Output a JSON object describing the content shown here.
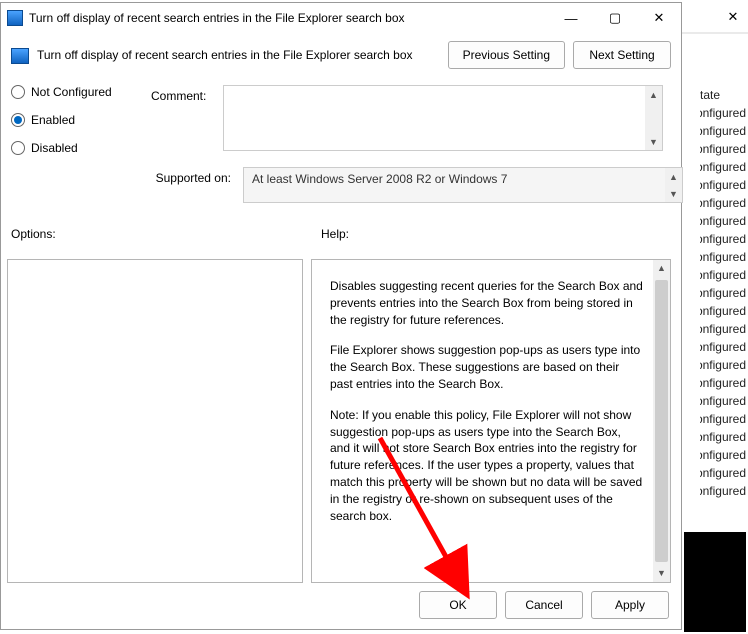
{
  "window": {
    "title": "Turn off display of recent search entries in the File Explorer search box",
    "subtitle": "Turn off display of recent search entries in the File Explorer search box"
  },
  "buttons": {
    "previous": "Previous Setting",
    "next": "Next Setting",
    "ok": "OK",
    "cancel": "Cancel",
    "apply": "Apply"
  },
  "radios": {
    "not_configured": "Not Configured",
    "enabled": "Enabled",
    "disabled": "Disabled",
    "selected": "enabled"
  },
  "labels": {
    "comment": "Comment:",
    "supported_on": "Supported on:",
    "options": "Options:",
    "help": "Help:"
  },
  "values": {
    "comment": "",
    "supported_on": "At least Windows Server 2008 R2 or Windows 7"
  },
  "help": {
    "p1": "Disables suggesting recent queries for the Search Box and prevents entries into the Search Box from being stored in the registry for future references.",
    "p2": "File Explorer shows suggestion pop-ups as users type into the Search Box.  These suggestions are based on their past entries into the Search Box.",
    "p3": "Note: If you enable this policy, File Explorer will not show suggestion pop-ups as users type into the Search Box, and it will not store Search Box entries into the registry for future references.  If the user types a property, values that match this property will be shown but no data will be saved in the registry or re-shown on subsequent uses of the search box."
  },
  "parent": {
    "header": "tate",
    "items": [
      "onfigured",
      "onfigured",
      "onfigured",
      "onfigured",
      "onfigured",
      "onfigured",
      "onfigured",
      "onfigured",
      "onfigured",
      "onfigured",
      "onfigured",
      "onfigured",
      "onfigured",
      "onfigured",
      "onfigured",
      "onfigured",
      "onfigured",
      "onfigured",
      "onfigured",
      "onfigured",
      "onfigured",
      "onfigured"
    ]
  }
}
